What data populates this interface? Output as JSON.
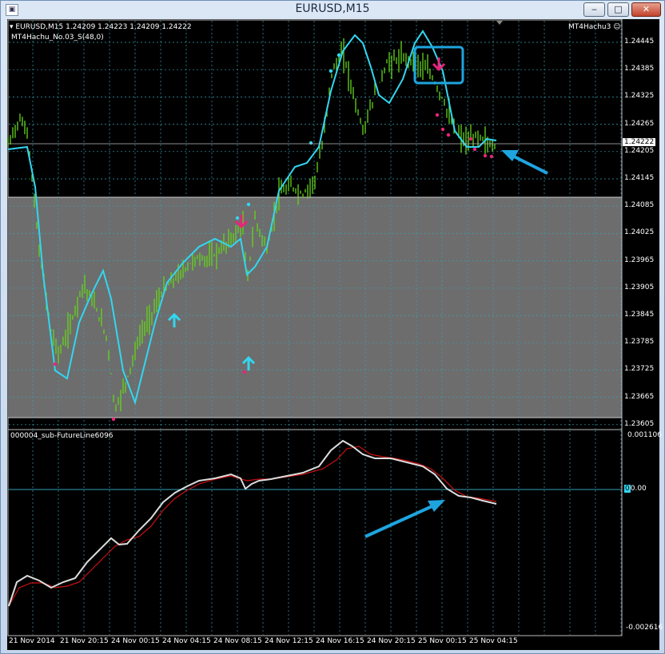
{
  "window": {
    "title": "EURUSD,M15",
    "minimize": "0",
    "restore": "1",
    "close": "r"
  },
  "main": {
    "header": "EURUSD,M15  1.24209 1.24223 1.24209 1.24222",
    "indicator": "MT4Hachu_No.03_S(48,0)",
    "ea": "MT4Hachu3 ☺",
    "price_tag": "1.24222",
    "price_labels": [
      "1.24445",
      "1.24385",
      "1.24325",
      "1.24265",
      "1.24205",
      "1.24145",
      "1.24085",
      "1.24025",
      "1.23965",
      "1.23905",
      "1.23845",
      "1.23785",
      "1.23725",
      "1.23665",
      "1.23605"
    ]
  },
  "sub": {
    "name": "000004_sub-FutureLine6096",
    "top": "0.001106",
    "bottom": "-0.002616",
    "level": "0.00",
    "level_badge": "0"
  },
  "time_labels": [
    "21 Nov 2014",
    "21 Nov 20:15",
    "24 Nov 00:15",
    "24 Nov 04:15",
    "24 Nov 08:15",
    "24 Nov 12:15",
    "24 Nov 16:15",
    "24 Nov 20:15",
    "25 Nov 00:15",
    "25 Nov 04:15"
  ],
  "colors": {
    "background": "#000000",
    "candle": "#66d41a",
    "ma": "#33d6f0",
    "zone": "#6d6d6d",
    "sub_white": "#dddddd",
    "sub_red": "#cc1111",
    "annotation": "#1ea5e0",
    "signal_up": "#33d6f0",
    "signal_down": "#e8247a"
  }
}
